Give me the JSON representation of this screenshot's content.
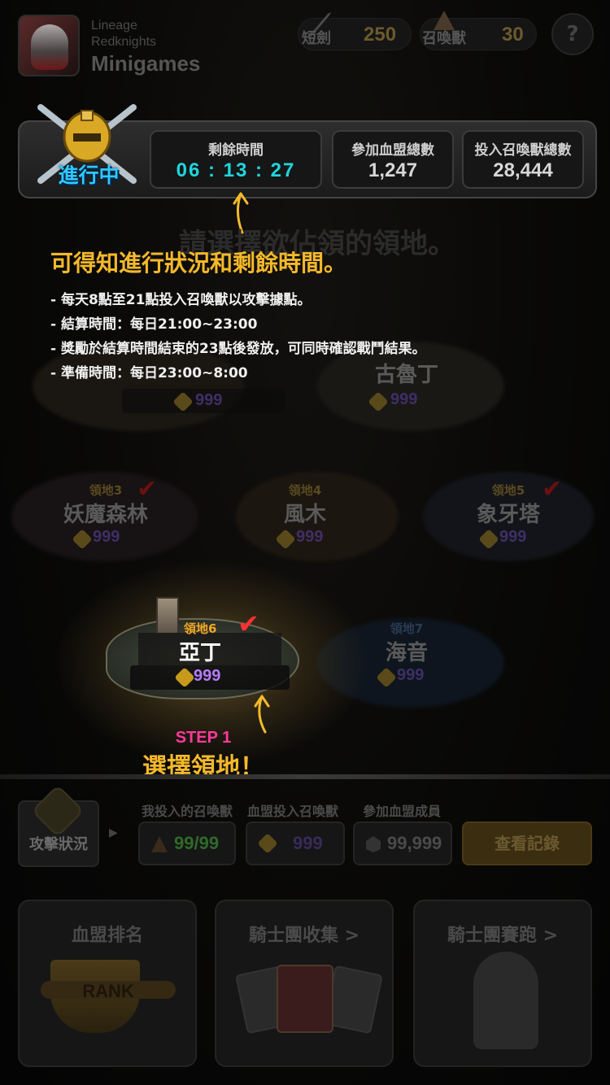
{
  "header": {
    "app_title_line1": "Lineage",
    "app_title_line2": "Redknights",
    "app_title_line3": "Minigames",
    "dagger_label": "短劍",
    "dagger_count": "250",
    "summon_label": "召喚獸",
    "summon_count": "30",
    "help_label": "?"
  },
  "status": {
    "badge_text": "進行中",
    "remaining_label": "剩餘時間",
    "remaining_value": "06 : 13 : 27",
    "clans_label": "參加血盟總數",
    "clans_value": "1,247",
    "summons_label": "投入召喚獸總數",
    "summons_value": "28,444"
  },
  "tutorial": {
    "background_title": "請選擇欲佔領的領地。",
    "headline": "可得知進行狀況和剩餘時間。",
    "rules": [
      "- 每天8點至21點投入召喚獸以攻擊據點。",
      "- 結算時間：每日21:00~23:00",
      "- 獎勵於結算時間結束的23點後發放，可同時確認戰鬥結果。",
      "- 準備時間：每日23:00~8:00"
    ],
    "step_number": "STEP 1",
    "step_text": "選擇領地！"
  },
  "territories": [
    {
      "sub": "",
      "name": "",
      "count": "999"
    },
    {
      "sub": "",
      "name": "古魯丁",
      "count": "999"
    },
    {
      "sub": "領地3",
      "name": "妖魔森林",
      "count": "999"
    },
    {
      "sub": "領地4",
      "name": "風木",
      "count": "999"
    },
    {
      "sub": "領地5",
      "name": "象牙塔",
      "count": "999"
    },
    {
      "sub": "領地6",
      "name": "亞丁",
      "count": "999"
    },
    {
      "sub": "領地7",
      "name": "海音",
      "count": "999"
    }
  ],
  "attack": {
    "label": "攻擊狀況",
    "my_summons_label": "我投入的召喚獸",
    "my_summons_value": "99/99",
    "clan_summons_label": "血盟投入召喚獸",
    "clan_summons_value": "999",
    "members_label": "參加血盟成員",
    "members_value": "99,999",
    "history_button": "查看記錄"
  },
  "cards": {
    "rank_title": "血盟排名",
    "rank_badge": "RANK",
    "collection_title": "騎士團收集 >",
    "race_title": "騎士團賽跑 >"
  },
  "colors": {
    "accent_gold": "#f5b92a",
    "timer_cyan": "#1fd6dd",
    "step_pink": "#ff3a9b",
    "badge_blue": "#2ec8ff",
    "check_red": "#ff3030",
    "count_purple": "#b77cff"
  },
  "icons": [
    "helmet-swords-icon",
    "dagger-icon",
    "summon-icon",
    "coin-icon",
    "check-icon",
    "arrow-up-icon",
    "help-icon",
    "crossed-swords-icon"
  ]
}
